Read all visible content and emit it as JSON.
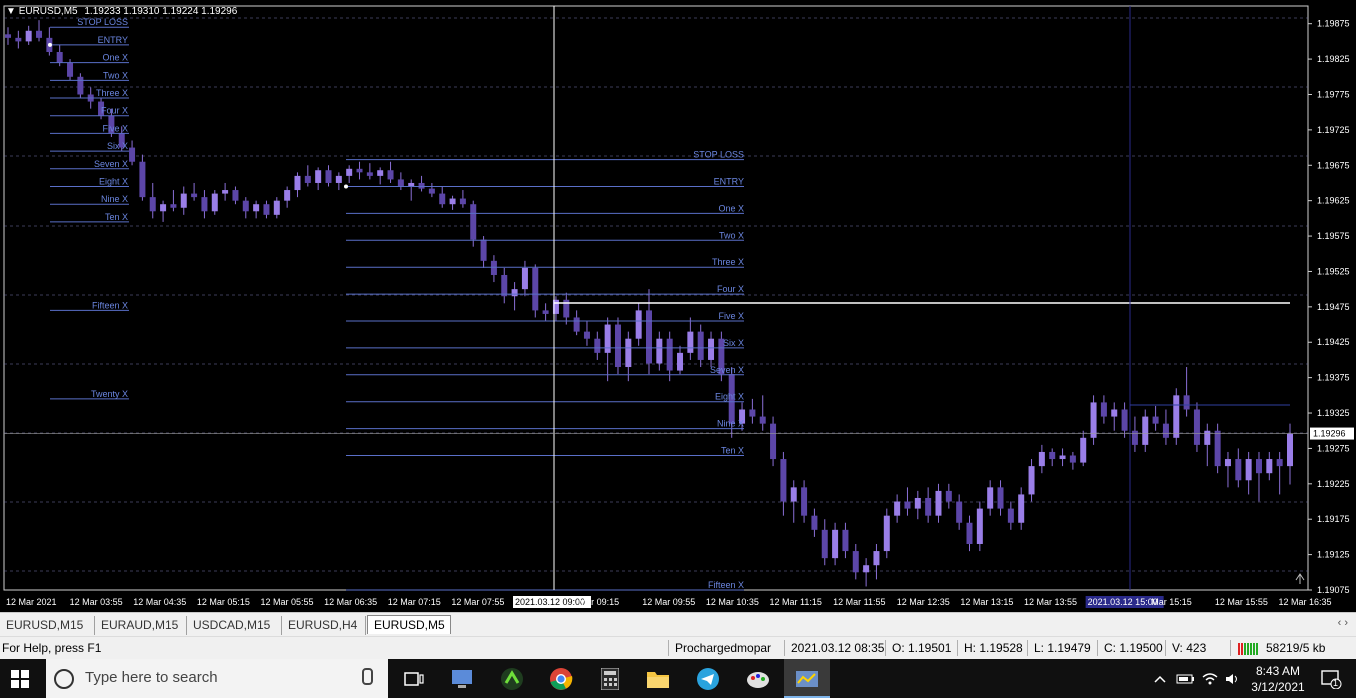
{
  "header": {
    "symbol_arrow": "▼",
    "symbol": "EURUSD,M5",
    "ohlc": "1.19233 1.19310 1.19224 1.19296"
  },
  "chart_data": {
    "type": "candlestick",
    "symbol": "EURUSD",
    "timeframe": "M5",
    "ylim": [
      1.19075,
      1.199
    ],
    "price_ticks": [
      "1.19875",
      "1.19825",
      "1.19775",
      "1.19725",
      "1.19675",
      "1.19625",
      "1.19575",
      "1.19525",
      "1.19475",
      "1.19425",
      "1.19375",
      "1.19325",
      "1.19275",
      "1.19225",
      "1.19175",
      "1.19125",
      "1.19075"
    ],
    "current_price": "1.19296",
    "time_ticks": [
      "12 Mar 2021",
      "12 Mar 03:55",
      "12 Mar 04:35",
      "12 Mar 05:15",
      "12 Mar 05:55",
      "12 Mar 06:35",
      "12 Mar 07:15",
      "12 Mar 07:55",
      "2021.03.12 09:00",
      "Mar 09:15",
      "12 Mar 09:55",
      "12 Mar 10:35",
      "12 Mar 11:15",
      "12 Mar 11:55",
      "12 Mar 12:35",
      "12 Mar 13:15",
      "12 Mar 13:55",
      "2021.03.12 15:00",
      "Mar 15:15",
      "12 Mar 15:55",
      "12 Mar 16:35"
    ],
    "level_sets": [
      {
        "entry": 1.19845,
        "levels": [
          {
            "label": "STOP LOSS",
            "price": 1.1987
          },
          {
            "label": "ENTRY",
            "price": 1.19845
          },
          {
            "label": "One X",
            "price": 1.1982
          },
          {
            "label": "Two X",
            "price": 1.19795
          },
          {
            "label": "Three X",
            "price": 1.1977
          },
          {
            "label": "Four X",
            "price": 1.19745
          },
          {
            "label": "Five X",
            "price": 1.1972
          },
          {
            "label": "Six X",
            "price": 1.19695
          },
          {
            "label": "Seven X",
            "price": 1.1967
          },
          {
            "label": "Eight X",
            "price": 1.19645
          },
          {
            "label": "Nine X",
            "price": 1.1962
          },
          {
            "label": "Ten X",
            "price": 1.19595
          },
          {
            "label": "Fifteen X",
            "price": 1.1947
          },
          {
            "label": "Twenty X",
            "price": 1.19345
          }
        ]
      },
      {
        "entry": 1.19645,
        "levels": [
          {
            "label": "STOP LOSS",
            "price": 1.19683
          },
          {
            "label": "ENTRY",
            "price": 1.19645
          },
          {
            "label": "One X",
            "price": 1.19607
          },
          {
            "label": "Two X",
            "price": 1.19569
          },
          {
            "label": "Three X",
            "price": 1.19531
          },
          {
            "label": "Four X",
            "price": 1.19493
          },
          {
            "label": "Five X",
            "price": 1.19455
          },
          {
            "label": "Six X",
            "price": 1.19417
          },
          {
            "label": "Seven X",
            "price": 1.19379
          },
          {
            "label": "Eight X",
            "price": 1.19341
          },
          {
            "label": "Nine X",
            "price": 1.19303
          },
          {
            "label": "Ten X",
            "price": 1.19265
          },
          {
            "label": "Fifteen X",
            "price": 1.19075
          }
        ]
      }
    ],
    "candles": [
      [
        1.1986,
        1.1987,
        1.19845,
        1.19855
      ],
      [
        1.19855,
        1.19865,
        1.1984,
        1.1985
      ],
      [
        1.1985,
        1.19872,
        1.19845,
        1.19865
      ],
      [
        1.19865,
        1.1988,
        1.1985,
        1.19855
      ],
      [
        1.19855,
        1.1987,
        1.1983,
        1.19835
      ],
      [
        1.19835,
        1.19845,
        1.19815,
        1.1982
      ],
      [
        1.1982,
        1.19825,
        1.19795,
        1.198
      ],
      [
        1.198,
        1.19805,
        1.1977,
        1.19775
      ],
      [
        1.19775,
        1.19785,
        1.19755,
        1.19765
      ],
      [
        1.19765,
        1.1977,
        1.1974,
        1.19745
      ],
      [
        1.19745,
        1.19755,
        1.19715,
        1.1972
      ],
      [
        1.1972,
        1.1973,
        1.19695,
        1.197
      ],
      [
        1.197,
        1.1971,
        1.19675,
        1.1968
      ],
      [
        1.1968,
        1.1969,
        1.19625,
        1.1963
      ],
      [
        1.1963,
        1.1965,
        1.196,
        1.1961
      ],
      [
        1.1961,
        1.19625,
        1.19595,
        1.1962
      ],
      [
        1.1962,
        1.1964,
        1.1961,
        1.19615
      ],
      [
        1.19615,
        1.19645,
        1.19605,
        1.19635
      ],
      [
        1.19635,
        1.1965,
        1.19625,
        1.1963
      ],
      [
        1.1963,
        1.1964,
        1.196,
        1.1961
      ],
      [
        1.1961,
        1.1964,
        1.19605,
        1.19635
      ],
      [
        1.19635,
        1.1965,
        1.19625,
        1.1964
      ],
      [
        1.1964,
        1.19645,
        1.1962,
        1.19625
      ],
      [
        1.19625,
        1.1963,
        1.196,
        1.1961
      ],
      [
        1.1961,
        1.19625,
        1.196,
        1.1962
      ],
      [
        1.1962,
        1.19625,
        1.196,
        1.19605
      ],
      [
        1.19605,
        1.1963,
        1.196,
        1.19625
      ],
      [
        1.19625,
        1.19645,
        1.19615,
        1.1964
      ],
      [
        1.1964,
        1.19665,
        1.1963,
        1.1966
      ],
      [
        1.1966,
        1.19675,
        1.19645,
        1.1965
      ],
      [
        1.1965,
        1.19672,
        1.1964,
        1.19668
      ],
      [
        1.19668,
        1.19675,
        1.19645,
        1.1965
      ],
      [
        1.1965,
        1.19665,
        1.1964,
        1.1966
      ],
      [
        1.1966,
        1.19675,
        1.1965,
        1.1967
      ],
      [
        1.1967,
        1.1968,
        1.19655,
        1.19665
      ],
      [
        1.19665,
        1.19678,
        1.19655,
        1.1966
      ],
      [
        1.1966,
        1.19672,
        1.19648,
        1.19668
      ],
      [
        1.19668,
        1.1968,
        1.1965,
        1.19655
      ],
      [
        1.19655,
        1.19665,
        1.1964,
        1.19645
      ],
      [
        1.19645,
        1.19655,
        1.19625,
        1.1965
      ],
      [
        1.1965,
        1.1966,
        1.19638,
        1.19642
      ],
      [
        1.19642,
        1.1965,
        1.1963,
        1.19635
      ],
      [
        1.19635,
        1.19645,
        1.19615,
        1.1962
      ],
      [
        1.1962,
        1.19632,
        1.19612,
        1.19628
      ],
      [
        1.19628,
        1.1964,
        1.19615,
        1.1962
      ],
      [
        1.1962,
        1.19625,
        1.1956,
        1.1957
      ],
      [
        1.1957,
        1.19575,
        1.1953,
        1.1954
      ],
      [
        1.1954,
        1.19548,
        1.1951,
        1.1952
      ],
      [
        1.1952,
        1.1953,
        1.1948,
        1.1949
      ],
      [
        1.1949,
        1.1951,
        1.1947,
        1.195
      ],
      [
        1.195,
        1.1954,
        1.1949,
        1.1953
      ],
      [
        1.1953,
        1.19535,
        1.1946,
        1.1947
      ],
      [
        1.1947,
        1.1948,
        1.19455,
        1.19465
      ],
      [
        1.19465,
        1.1949,
        1.19455,
        1.19485
      ],
      [
        1.19485,
        1.19495,
        1.1945,
        1.1946
      ],
      [
        1.1946,
        1.1947,
        1.19435,
        1.1944
      ],
      [
        1.1944,
        1.19455,
        1.1942,
        1.1943
      ],
      [
        1.1943,
        1.1944,
        1.194,
        1.1941
      ],
      [
        1.1941,
        1.1946,
        1.1937,
        1.1945
      ],
      [
        1.1945,
        1.1946,
        1.1938,
        1.1939
      ],
      [
        1.1939,
        1.1944,
        1.1937,
        1.1943
      ],
      [
        1.1943,
        1.1948,
        1.1942,
        1.1947
      ],
      [
        1.1947,
        1.195,
        1.1938,
        1.19395
      ],
      [
        1.19395,
        1.1944,
        1.19385,
        1.1943
      ],
      [
        1.1943,
        1.1944,
        1.1937,
        1.19385
      ],
      [
        1.19385,
        1.1942,
        1.1938,
        1.1941
      ],
      [
        1.1941,
        1.1946,
        1.194,
        1.1944
      ],
      [
        1.1944,
        1.1945,
        1.1939,
        1.194
      ],
      [
        1.194,
        1.1944,
        1.1939,
        1.1943
      ],
      [
        1.1943,
        1.1944,
        1.1937,
        1.1938
      ],
      [
        1.1938,
        1.1939,
        1.1929,
        1.1931
      ],
      [
        1.1931,
        1.1934,
        1.193,
        1.1933
      ],
      [
        1.1933,
        1.19345,
        1.1931,
        1.1932
      ],
      [
        1.1932,
        1.1935,
        1.193,
        1.1931
      ],
      [
        1.1931,
        1.1932,
        1.1925,
        1.1926
      ],
      [
        1.1926,
        1.1927,
        1.1918,
        1.192
      ],
      [
        1.192,
        1.1923,
        1.1917,
        1.1922
      ],
      [
        1.1922,
        1.1923,
        1.1917,
        1.1918
      ],
      [
        1.1918,
        1.1919,
        1.1915,
        1.1916
      ],
      [
        1.1916,
        1.19175,
        1.1911,
        1.1912
      ],
      [
        1.1912,
        1.1917,
        1.1911,
        1.1916
      ],
      [
        1.1916,
        1.1917,
        1.1912,
        1.1913
      ],
      [
        1.1913,
        1.1914,
        1.1909,
        1.191
      ],
      [
        1.191,
        1.1912,
        1.1908,
        1.1911
      ],
      [
        1.1911,
        1.1914,
        1.1909,
        1.1913
      ],
      [
        1.1913,
        1.1919,
        1.1912,
        1.1918
      ],
      [
        1.1918,
        1.1921,
        1.1917,
        1.192
      ],
      [
        1.192,
        1.1922,
        1.1918,
        1.1919
      ],
      [
        1.1919,
        1.19215,
        1.19175,
        1.19205
      ],
      [
        1.19205,
        1.1922,
        1.1917,
        1.1918
      ],
      [
        1.1918,
        1.19225,
        1.1917,
        1.19215
      ],
      [
        1.19215,
        1.19225,
        1.1919,
        1.192
      ],
      [
        1.192,
        1.1921,
        1.1916,
        1.1917
      ],
      [
        1.1917,
        1.1918,
        1.1913,
        1.1914
      ],
      [
        1.1914,
        1.192,
        1.1913,
        1.1919
      ],
      [
        1.1919,
        1.1923,
        1.1918,
        1.1922
      ],
      [
        1.1922,
        1.1923,
        1.1918,
        1.1919
      ],
      [
        1.1919,
        1.192,
        1.1916,
        1.1917
      ],
      [
        1.1917,
        1.1922,
        1.1916,
        1.1921
      ],
      [
        1.1921,
        1.1926,
        1.192,
        1.1925
      ],
      [
        1.1925,
        1.1928,
        1.1924,
        1.1927
      ],
      [
        1.1927,
        1.19275,
        1.1925,
        1.1926
      ],
      [
        1.1926,
        1.19275,
        1.1925,
        1.19265
      ],
      [
        1.19265,
        1.1927,
        1.19245,
        1.19255
      ],
      [
        1.19255,
        1.193,
        1.1925,
        1.1929
      ],
      [
        1.1929,
        1.1935,
        1.1928,
        1.1934
      ],
      [
        1.1934,
        1.1935,
        1.1931,
        1.1932
      ],
      [
        1.1932,
        1.1934,
        1.193,
        1.1933
      ],
      [
        1.1933,
        1.1934,
        1.1929,
        1.193
      ],
      [
        1.193,
        1.1932,
        1.1927,
        1.1928
      ],
      [
        1.1928,
        1.1933,
        1.1927,
        1.1932
      ],
      [
        1.1932,
        1.19335,
        1.193,
        1.1931
      ],
      [
        1.1931,
        1.1933,
        1.1928,
        1.1929
      ],
      [
        1.1929,
        1.1936,
        1.1928,
        1.1935
      ],
      [
        1.1935,
        1.1939,
        1.1932,
        1.1933
      ],
      [
        1.1933,
        1.1934,
        1.1927,
        1.1928
      ],
      [
        1.1928,
        1.1931,
        1.1925,
        1.193
      ],
      [
        1.193,
        1.1931,
        1.1924,
        1.1925
      ],
      [
        1.1925,
        1.1927,
        1.1922,
        1.1926
      ],
      [
        1.1926,
        1.19275,
        1.1922,
        1.1923
      ],
      [
        1.1923,
        1.1927,
        1.1921,
        1.1926
      ],
      [
        1.1926,
        1.1927,
        1.192,
        1.1924
      ],
      [
        1.1924,
        1.1927,
        1.1923,
        1.1926
      ],
      [
        1.1926,
        1.1927,
        1.1921,
        1.1925
      ],
      [
        1.1925,
        1.1931,
        1.19224,
        1.19296
      ]
    ]
  },
  "tabs": [
    {
      "label": "EURUSD,M15"
    },
    {
      "label": "EURAUD,M15"
    },
    {
      "label": "USDCAD,M15"
    },
    {
      "label": "EURUSD,H4"
    },
    {
      "label": "EURUSD,M5"
    }
  ],
  "tab_nav": "‹ ›",
  "status": {
    "help": "For Help, press F1",
    "profile": "Prochargedmopar",
    "datetime": "2021.03.12 08:35",
    "open": "O: 1.19501",
    "high": "H: 1.19528",
    "low": "L: 1.19479",
    "close": "C: 1.19500",
    "volume": "V: 423",
    "traffic": "58219/5 kb"
  },
  "taskbar": {
    "search_placeholder": "Type here to search",
    "time": "8:43 AM",
    "date": "3/12/2021",
    "notification_count": "1"
  }
}
